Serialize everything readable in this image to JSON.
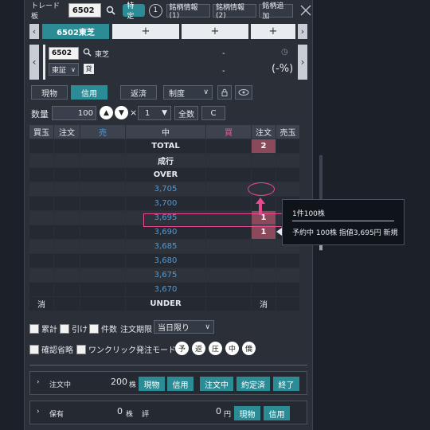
{
  "title": "トレード板",
  "stock_code": "6502",
  "header_buttons": {
    "tokutei": "特定",
    "account_num": "1",
    "info1": "銘柄情報(1)",
    "info2": "銘柄情報(2)",
    "add": "銘柄追加"
  },
  "tabs": [
    {
      "label": "6502東芝"
    },
    {
      "label": "+"
    },
    {
      "label": "+"
    },
    {
      "label": "+"
    }
  ],
  "stock": {
    "code": "6502",
    "name": "東芝",
    "market": "東証",
    "badge": "貸",
    "price": "-",
    "change": "-",
    "pct": "(-%)"
  },
  "order_types": {
    "genbutsu": "現物",
    "shinyo": "信用",
    "hensai": "返済",
    "seido": "制度"
  },
  "quantity": {
    "label": "数量",
    "value": "100",
    "multiplier": "×",
    "unit_value": "1",
    "all": "全数",
    "clear": "C"
  },
  "board": {
    "headers": [
      "買玉",
      "注文",
      "売",
      "中",
      "買",
      "注文",
      "売玉"
    ],
    "rows": [
      {
        "mid": "TOTAL",
        "buy_order": "2",
        "buy_pink": true,
        "price": false
      },
      {
        "mid": "成行",
        "buy_order": "",
        "price": false
      },
      {
        "mid": "OVER",
        "buy_order": "",
        "price": false
      },
      {
        "mid": "3,705",
        "buy_order": "",
        "price": true
      },
      {
        "mid": "3,700",
        "buy_order": "",
        "price": true
      },
      {
        "mid": "3,695",
        "buy_order": "1",
        "buy_pink": true,
        "price": true
      },
      {
        "mid": "3,690",
        "buy_order": "1",
        "buy_pink": true,
        "price": true
      },
      {
        "mid": "3,685",
        "buy_order": "",
        "price": true
      },
      {
        "mid": "3,680",
        "buy_order": "",
        "price": true
      },
      {
        "mid": "3,675",
        "buy_order": "",
        "price": true
      },
      {
        "mid": "3,670",
        "buy_order": "",
        "price": true
      }
    ],
    "footer": {
      "left": "消",
      "mid": "UNDER",
      "right": "消"
    }
  },
  "tooltip": {
    "line1": "1件100株",
    "line2": "予約中 100株 指値3,695円 新規"
  },
  "options": {
    "ruikei": "累計",
    "hike": "引け",
    "kensu": "件数",
    "kigen_label": "注文期限",
    "kigen_value": "当日限り",
    "kakunin": "確認省略",
    "oneclick": "ワンクリック発注モード",
    "circles": [
      "予",
      "返",
      "圧",
      "中",
      "僑"
    ]
  },
  "summary1": {
    "label": "注文中",
    "value": "200",
    "unit": "株",
    "buttons": [
      "現物",
      "信用",
      "注文中",
      "約定済",
      "終了"
    ]
  },
  "summary2": {
    "label": "保有",
    "value": "0",
    "unit": "株",
    "hyoka_label": "評",
    "hyoka_value": "0",
    "hyoka_unit": "円",
    "buttons": [
      "現物",
      "信用"
    ]
  },
  "colors": {
    "accent": "#2b8c96",
    "pink": "#e84a92",
    "sell_blue": "#4f9bd8",
    "panel_bg": "#2a2f38"
  }
}
